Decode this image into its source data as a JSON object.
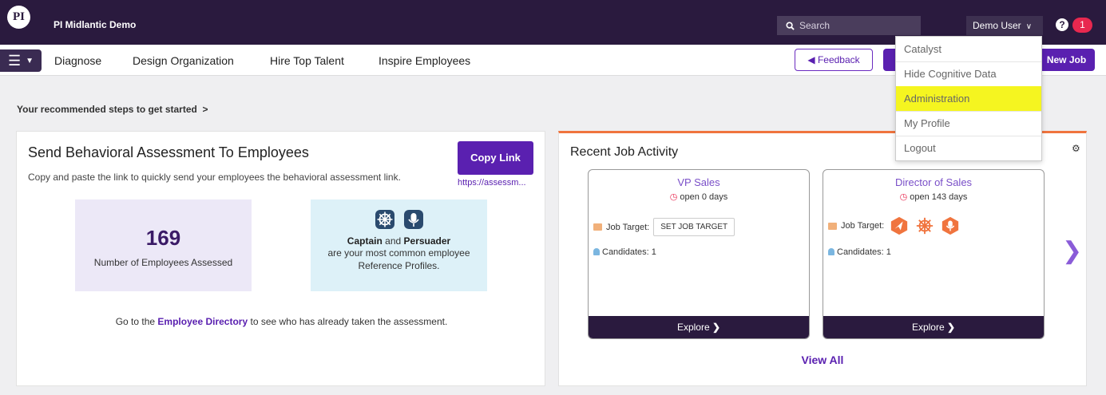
{
  "topbar": {
    "logo_text": "PI",
    "org_name": "PI Midlantic Demo",
    "search_placeholder": "Search",
    "user_name": "Demo User",
    "notification_count": "1",
    "help_symbol": "?"
  },
  "nav": {
    "items": [
      "Diagnose",
      "Design Organization",
      "Hire Top Talent",
      "Inspire Employees"
    ],
    "feedback_label": "Feedback",
    "new_job_label": "New Job"
  },
  "user_menu": {
    "items": [
      "Catalyst",
      "Hide Cognitive Data",
      "Administration",
      "My Profile",
      "Logout"
    ],
    "highlighted": "Administration",
    "highlight_color": "#f5f520"
  },
  "recommended": {
    "label": "Your recommended steps to get started",
    "chevron": ">"
  },
  "assessment_card": {
    "title": "Send Behavioral Assessment To Employees",
    "description": "Copy and paste the link to quickly send your employees the behavioral assessment link.",
    "copy_link_label": "Copy Link",
    "link_text": "https://assessm...",
    "employees_assessed": "169",
    "employees_assessed_label": "Number of Employees Assessed",
    "profile_1": "Captain",
    "profile_and": "and",
    "profile_2": "Persuader",
    "profile_line2": "are your most common employee",
    "profile_line3": "Reference Profiles.",
    "directory_prefix": "Go to the",
    "directory_link": "Employee Directory",
    "directory_suffix": "to see who has already taken the assessment."
  },
  "job_activity": {
    "title": "Recent Job Activity",
    "jobs": [
      {
        "title": "VP Sales",
        "open_text": "open 0 days",
        "job_target_label": "Job Target:",
        "set_target_label": "SET JOB TARGET",
        "candidates": "Candidates: 1",
        "explore_label": "Explore"
      },
      {
        "title": "Director of Sales",
        "open_text": "open 143 days",
        "job_target_label": "Job Target:",
        "candidates": "Candidates: 1",
        "explore_label": "Explore"
      }
    ],
    "view_all_label": "View All"
  },
  "colors": {
    "topbar_bg": "#2a1a3e",
    "brand_purple": "#5a20b0",
    "accent_orange": "#f0743e",
    "badge_red": "#e8284f"
  }
}
